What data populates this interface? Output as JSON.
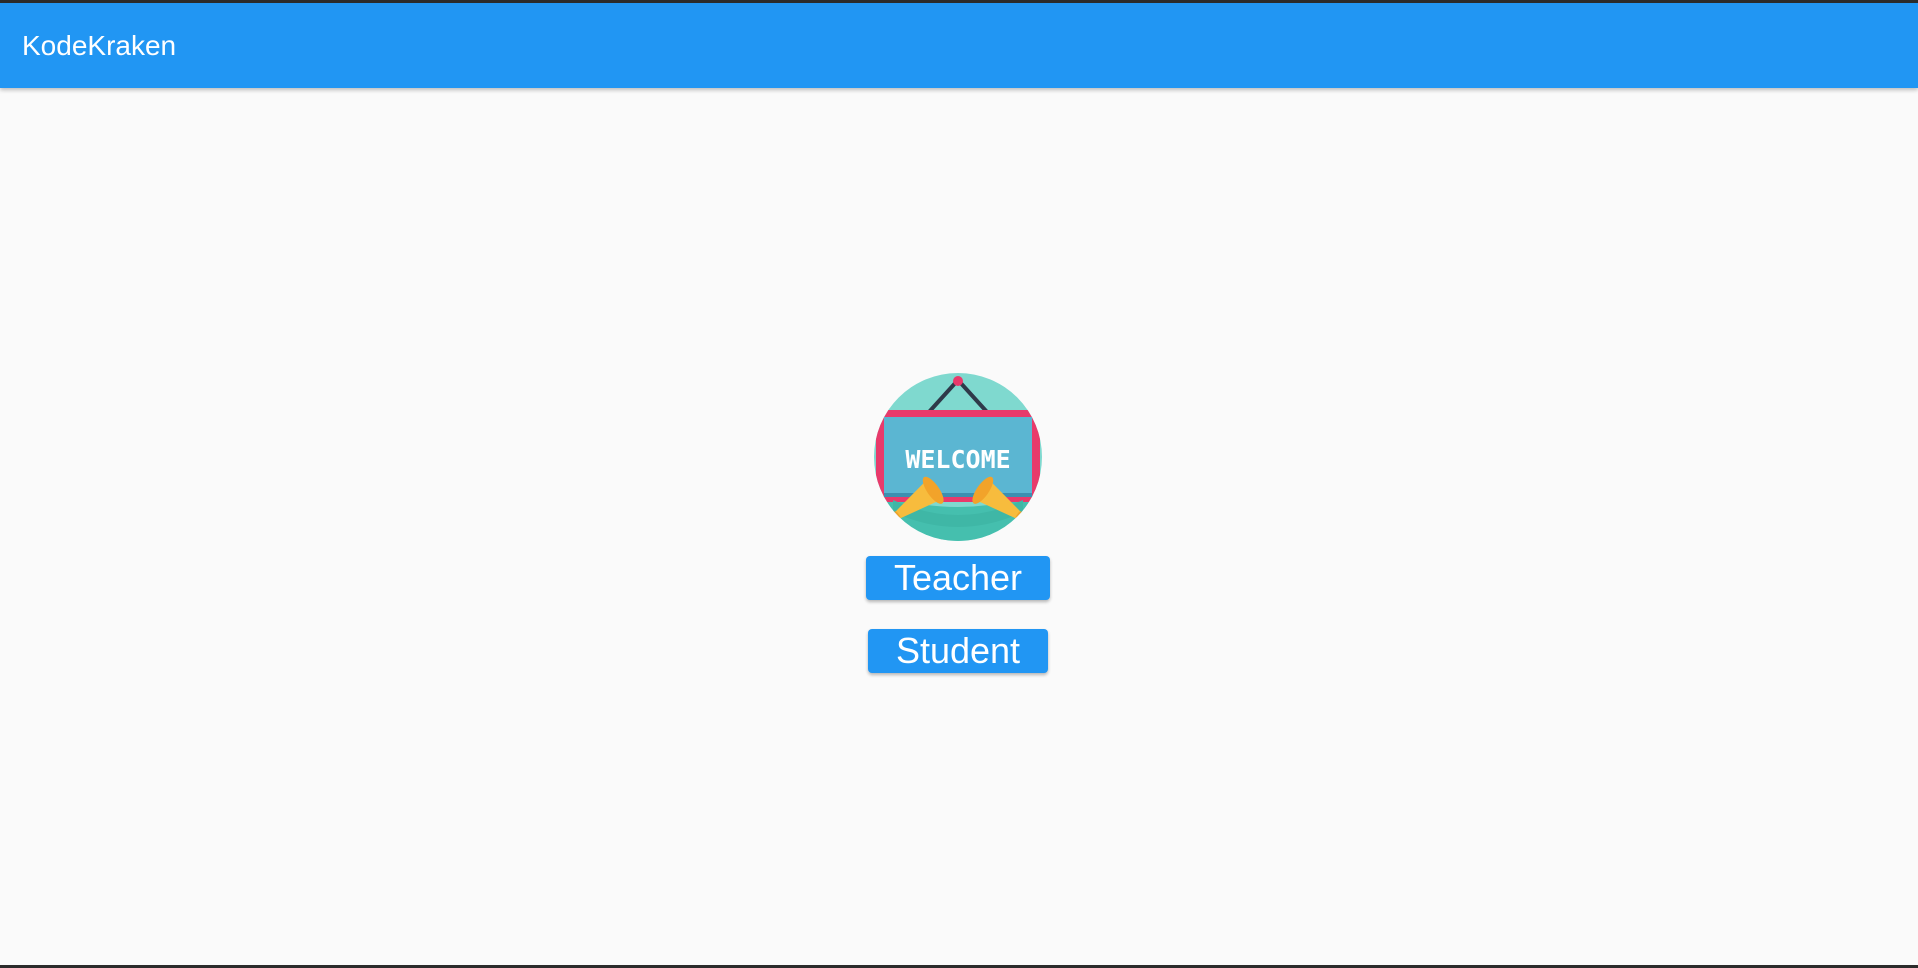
{
  "app_bar": {
    "title": "KodeKraken"
  },
  "main": {
    "logo": {
      "sign_text": "WELCOME"
    },
    "teacher_label": "Teacher",
    "student_label": "Student"
  },
  "colors": {
    "primary": "#2196f3",
    "background": "#fafafa",
    "sign_frame": "#e83a6b",
    "sign_board": "#5bb6d2",
    "circle_bg": "#7fd9cf",
    "trumpet": "#f7bc3d"
  },
  "icons": [
    "welcome-sign-icon"
  ]
}
